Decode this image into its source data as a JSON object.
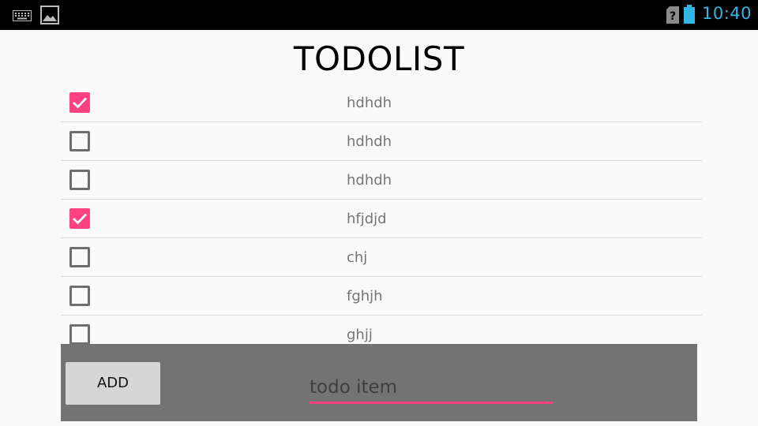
{
  "status_bar": {
    "time": "10:40",
    "icons": [
      "keyboard-icon",
      "image-icon",
      "sim-unknown-icon",
      "battery-icon"
    ],
    "time_color": "#33b5e5"
  },
  "app": {
    "title": "TODOLIST"
  },
  "todo_items": [
    {
      "text": "hdhdh",
      "checked": true
    },
    {
      "text": "hdhdh",
      "checked": false
    },
    {
      "text": "hdhdh",
      "checked": false
    },
    {
      "text": "hfjdjd",
      "checked": true
    },
    {
      "text": "chj",
      "checked": false
    },
    {
      "text": "fghjh",
      "checked": false
    },
    {
      "text": "ghjj",
      "checked": false
    }
  ],
  "add_bar": {
    "add_label": "ADD",
    "input_placeholder": "todo item",
    "input_value": ""
  },
  "colors": {
    "accent": "#ff4081",
    "panel": "#737373"
  }
}
